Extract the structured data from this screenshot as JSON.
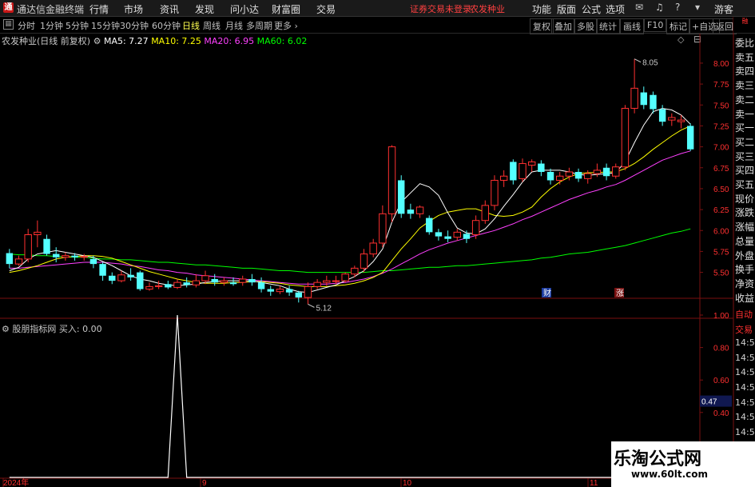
{
  "titlebar": {
    "app_title": "通达信金融终端",
    "menus": [
      "行情",
      "市场",
      "资讯",
      "发现",
      "问小达",
      "财富圈",
      "交易"
    ],
    "status_red": "证券交易未登录",
    "stock_red": "农发种业",
    "right_menus": [
      "功能",
      "版面",
      "公式",
      "选项"
    ],
    "guest": "游客"
  },
  "periods": {
    "items": [
      "分时",
      "1分钟",
      "5分钟",
      "15分钟",
      "30分钟",
      "60分钟",
      "日线",
      "周线",
      "月线",
      "多周期",
      "更多"
    ],
    "active": "日线"
  },
  "tools": [
    "复权",
    "叠加",
    "多股",
    "统计",
    "画线",
    "F10",
    "标记",
    "+自选",
    "返回"
  ],
  "main": {
    "stock_name": "农发种业(日线 前复权)",
    "ma5": "MA5: 7.27",
    "ma10": "MA10: 7.25",
    "ma20": "MA20: 6.95",
    "ma60": "MA60: 6.02",
    "high_label": "8.05",
    "low_label": "5.12",
    "price_ticks": [
      "8.00",
      "7.75",
      "7.50",
      "7.25",
      "7.00",
      "6.75",
      "6.50",
      "6.25",
      "6.00",
      "5.75",
      "5.50"
    ],
    "badge_cai": "财",
    "badge_zhang": "涨",
    "colors": {
      "up": "#ff3030",
      "down": "#54ffff",
      "ma5": "#ffffff",
      "ma10": "#ffff00",
      "ma20": "#ff40ff",
      "ma60": "#00ff00"
    }
  },
  "indicator": {
    "name": "股朋指标网",
    "value_label": "买入: 0.00",
    "ticks": [
      "1.00",
      "0.80",
      "0.60",
      "0.40",
      "0.20"
    ],
    "current": "0.47"
  },
  "xaxis": {
    "labels": [
      "2024年",
      "9",
      "10",
      "11"
    ]
  },
  "sidebar": {
    "items": [
      "委比",
      "卖五",
      "卖四",
      "卖三",
      "卖二",
      "卖一",
      "买一",
      "买二",
      "买三",
      "买四",
      "买五",
      "现价",
      "涨跌",
      "涨幅",
      "总量",
      "外盘",
      "换手",
      "净资",
      "收益"
    ],
    "top_badge": "融"
  },
  "sidebar2": {
    "items": [
      "自动",
      "交易",
      "14:56",
      "14:56",
      "14:56",
      "14:56",
      "14:56",
      "14:56",
      "14:56",
      "14:56"
    ]
  },
  "watermark": {
    "line1": "乐淘公式网",
    "line2": "www.60lt.com"
  },
  "chart_data": {
    "type": "candlestick",
    "ylim": [
      5.2,
      8.2
    ],
    "candles": [
      [
        5.73,
        5.6,
        5.78,
        5.55
      ],
      [
        5.6,
        5.66,
        5.7,
        5.58
      ],
      [
        5.66,
        5.95,
        6.02,
        5.62
      ],
      [
        5.95,
        5.98,
        6.12,
        5.8
      ],
      [
        5.9,
        5.72,
        5.95,
        5.7
      ],
      [
        5.72,
        5.68,
        5.8,
        5.62
      ],
      [
        5.68,
        5.7,
        5.74,
        5.64
      ],
      [
        5.7,
        5.68,
        5.73,
        5.64
      ],
      [
        5.68,
        5.69,
        5.72,
        5.64
      ],
      [
        5.66,
        5.6,
        5.7,
        5.55
      ],
      [
        5.6,
        5.46,
        5.62,
        5.4
      ],
      [
        5.46,
        5.4,
        5.5,
        5.36
      ],
      [
        5.4,
        5.47,
        5.52,
        5.38
      ],
      [
        5.47,
        5.44,
        5.55,
        5.4
      ],
      [
        5.5,
        5.3,
        5.52,
        5.28
      ],
      [
        5.3,
        5.33,
        5.38,
        5.28
      ],
      [
        5.33,
        5.34,
        5.4,
        5.3
      ],
      [
        5.36,
        5.32,
        5.4,
        5.3
      ],
      [
        5.32,
        5.38,
        5.42,
        5.3
      ],
      [
        5.38,
        5.35,
        5.44,
        5.32
      ],
      [
        5.35,
        5.4,
        5.48,
        5.32
      ],
      [
        5.4,
        5.46,
        5.52,
        5.36
      ],
      [
        5.42,
        5.38,
        5.48,
        5.34
      ],
      [
        5.38,
        5.4,
        5.44,
        5.34
      ],
      [
        5.38,
        5.36,
        5.44,
        5.34
      ],
      [
        5.38,
        5.42,
        5.46,
        5.34
      ],
      [
        5.42,
        5.38,
        5.48,
        5.34
      ],
      [
        5.38,
        5.3,
        5.44,
        5.26
      ],
      [
        5.3,
        5.27,
        5.34,
        5.22
      ],
      [
        5.27,
        5.3,
        5.34,
        5.24
      ],
      [
        5.3,
        5.26,
        5.34,
        5.22
      ],
      [
        5.26,
        5.2,
        5.28,
        5.14
      ],
      [
        5.2,
        5.33,
        5.38,
        5.12
      ],
      [
        5.33,
        5.38,
        5.42,
        5.3
      ],
      [
        5.38,
        5.4,
        5.46,
        5.34
      ],
      [
        5.4,
        5.4,
        5.46,
        5.36
      ],
      [
        5.4,
        5.48,
        5.5,
        5.38
      ],
      [
        5.48,
        5.55,
        5.58,
        5.44
      ],
      [
        5.55,
        5.72,
        5.78,
        5.5
      ],
      [
        5.72,
        5.85,
        5.9,
        5.68
      ],
      [
        5.85,
        6.2,
        6.3,
        5.8
      ],
      [
        6.2,
        7.0,
        7.02,
        6.1
      ],
      [
        6.6,
        6.2,
        6.66,
        6.15
      ],
      [
        6.25,
        6.2,
        6.32,
        6.14
      ],
      [
        6.2,
        6.28,
        6.3,
        6.15
      ],
      [
        6.15,
        5.98,
        6.18,
        5.95
      ],
      [
        5.98,
        5.93,
        6.02,
        5.88
      ],
      [
        5.93,
        5.9,
        6.0,
        5.86
      ],
      [
        5.92,
        5.98,
        6.02,
        5.88
      ],
      [
        5.96,
        5.9,
        6.0,
        5.85
      ],
      [
        5.95,
        6.12,
        6.18,
        5.9
      ],
      [
        6.12,
        6.3,
        6.36,
        6.08
      ],
      [
        6.3,
        6.6,
        6.66,
        6.24
      ],
      [
        6.6,
        6.65,
        6.72,
        6.52
      ],
      [
        6.82,
        6.6,
        6.85,
        6.55
      ],
      [
        6.62,
        6.8,
        6.86,
        6.58
      ],
      [
        6.78,
        6.82,
        6.85,
        6.7
      ],
      [
        6.8,
        6.7,
        6.84,
        6.65
      ],
      [
        6.7,
        6.6,
        6.74,
        6.55
      ],
      [
        6.6,
        6.65,
        6.7,
        6.55
      ],
      [
        6.65,
        6.7,
        6.75,
        6.6
      ],
      [
        6.7,
        6.62,
        6.74,
        6.58
      ],
      [
        6.62,
        6.68,
        6.72,
        6.56
      ],
      [
        6.68,
        6.72,
        6.8,
        6.64
      ],
      [
        6.75,
        6.65,
        6.8,
        6.6
      ],
      [
        6.65,
        6.76,
        6.8,
        6.62
      ],
      [
        6.76,
        7.46,
        7.5,
        6.72
      ],
      [
        7.46,
        7.7,
        8.05,
        7.4
      ],
      [
        7.65,
        7.5,
        7.72,
        7.45
      ],
      [
        7.62,
        7.45,
        7.66,
        7.4
      ],
      [
        7.45,
        7.3,
        7.5,
        7.25
      ],
      [
        7.32,
        7.35,
        7.4,
        7.25
      ],
      [
        7.3,
        7.32,
        7.38,
        7.22
      ],
      [
        7.25,
        6.97,
        7.28,
        6.95
      ]
    ],
    "ma5": [
      5.52,
      5.56,
      5.66,
      5.72,
      5.74,
      5.76,
      5.74,
      5.72,
      5.7,
      5.68,
      5.63,
      5.58,
      5.52,
      5.46,
      5.42,
      5.4,
      5.37,
      5.35,
      5.34,
      5.35,
      5.36,
      5.38,
      5.39,
      5.4,
      5.4,
      5.4,
      5.4,
      5.38,
      5.36,
      5.34,
      5.3,
      5.27,
      5.26,
      5.29,
      5.32,
      5.35,
      5.4,
      5.45,
      5.52,
      5.63,
      5.78,
      6.1,
      6.34,
      6.45,
      6.56,
      6.52,
      6.42,
      6.21,
      6.03,
      5.97,
      5.96,
      6.02,
      6.14,
      6.29,
      6.43,
      6.58,
      6.7,
      6.72,
      6.72,
      6.72,
      6.7,
      6.67,
      6.66,
      6.67,
      6.68,
      6.69,
      6.82,
      7.05,
      7.26,
      7.42,
      7.46,
      7.44,
      7.38,
      7.27
    ],
    "ma10": [
      5.5,
      5.52,
      5.55,
      5.58,
      5.62,
      5.66,
      5.68,
      5.69,
      5.7,
      5.7,
      5.69,
      5.67,
      5.63,
      5.59,
      5.55,
      5.51,
      5.48,
      5.45,
      5.42,
      5.4,
      5.38,
      5.37,
      5.37,
      5.37,
      5.38,
      5.38,
      5.39,
      5.39,
      5.38,
      5.37,
      5.35,
      5.34,
      5.33,
      5.33,
      5.33,
      5.34,
      5.35,
      5.37,
      5.4,
      5.44,
      5.5,
      5.64,
      5.78,
      5.9,
      6.03,
      6.11,
      6.18,
      6.22,
      6.24,
      6.26,
      6.26,
      6.22,
      6.18,
      6.17,
      6.18,
      6.22,
      6.28,
      6.4,
      6.5,
      6.58,
      6.64,
      6.68,
      6.69,
      6.69,
      6.7,
      6.7,
      6.74,
      6.8,
      6.88,
      6.97,
      7.05,
      7.13,
      7.2,
      7.25
    ],
    "ma20": [
      5.55,
      5.55,
      5.56,
      5.57,
      5.58,
      5.59,
      5.6,
      5.61,
      5.62,
      5.62,
      5.62,
      5.61,
      5.6,
      5.58,
      5.57,
      5.55,
      5.53,
      5.52,
      5.5,
      5.49,
      5.47,
      5.46,
      5.45,
      5.44,
      5.43,
      5.42,
      5.41,
      5.4,
      5.39,
      5.38,
      5.37,
      5.36,
      5.36,
      5.36,
      5.36,
      5.37,
      5.38,
      5.4,
      5.42,
      5.45,
      5.49,
      5.54,
      5.6,
      5.66,
      5.72,
      5.77,
      5.81,
      5.85,
      5.88,
      5.91,
      5.94,
      5.97,
      6.0,
      6.04,
      6.08,
      6.13,
      6.17,
      6.22,
      6.27,
      6.32,
      6.37,
      6.41,
      6.45,
      6.48,
      6.52,
      6.55,
      6.6,
      6.66,
      6.72,
      6.78,
      6.84,
      6.88,
      6.92,
      6.95
    ],
    "ma60": [
      5.72,
      5.71,
      5.71,
      5.7,
      5.7,
      5.69,
      5.69,
      5.68,
      5.68,
      5.67,
      5.66,
      5.66,
      5.65,
      5.65,
      5.64,
      5.63,
      5.62,
      5.62,
      5.61,
      5.6,
      5.59,
      5.59,
      5.58,
      5.57,
      5.56,
      5.55,
      5.55,
      5.54,
      5.53,
      5.52,
      5.52,
      5.51,
      5.5,
      5.5,
      5.5,
      5.5,
      5.5,
      5.5,
      5.5,
      5.51,
      5.52,
      5.52,
      5.53,
      5.54,
      5.55,
      5.56,
      5.56,
      5.57,
      5.58,
      5.58,
      5.59,
      5.6,
      5.61,
      5.62,
      5.63,
      5.64,
      5.65,
      5.67,
      5.68,
      5.7,
      5.72,
      5.73,
      5.74,
      5.76,
      5.78,
      5.8,
      5.82,
      5.85,
      5.88,
      5.91,
      5.94,
      5.97,
      5.99,
      6.02
    ],
    "indicator_values": {
      "spike_index": 18,
      "spike_value": 1.0,
      "baseline": 0.0
    }
  }
}
